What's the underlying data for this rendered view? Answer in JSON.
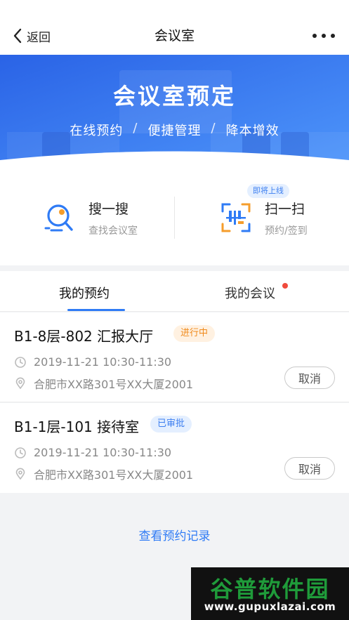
{
  "nav": {
    "back_label": "返回",
    "title": "会议室",
    "more_icon": "more-dots-icon"
  },
  "banner": {
    "title": "会议室预定",
    "subtitle": [
      "在线预约",
      "便捷管理",
      "降本增效"
    ],
    "separator": "/",
    "slide_count": 3,
    "active_slide": 1,
    "colors": {
      "from": "#2a63e6",
      "to": "#5aa3ff"
    }
  },
  "actions": {
    "search": {
      "title": "搜一搜",
      "subtitle": "查找会议室",
      "icon": "search-room-icon"
    },
    "scan": {
      "title": "扫一扫",
      "subtitle": "预约/签到",
      "icon": "qr-scan-icon",
      "badge": "即将上线"
    }
  },
  "tabs": {
    "items": [
      "我的预约",
      "我的会议"
    ],
    "active": 0,
    "notification_dot_on": "我的会议"
  },
  "bookings": [
    {
      "room": "B1-8层-802 汇报大厅",
      "status": "进行中",
      "time": "2019-11-21 10:30-11:30",
      "location": "合肥市XX路301号XX大厦2001",
      "action": "取消"
    },
    {
      "room": "B1-1层-101 接待室",
      "status": "已审批",
      "time": "2019-11-21 10:30-11:30",
      "location": "合肥市XX路301号XX大厦2001",
      "action": "取消"
    }
  ],
  "footer": {
    "history_link": "查看预约记录"
  },
  "watermark": {
    "name": "谷普软件园",
    "url": "www.gupuxlazai.com"
  },
  "colors": {
    "accent": "#2f7bf5",
    "ongoing": "#f08a1c",
    "approved": "#3d7ff0",
    "notify": "#f04a3c"
  }
}
